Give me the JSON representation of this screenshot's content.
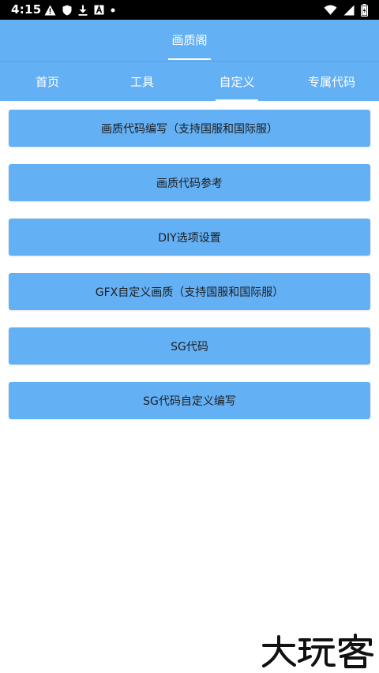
{
  "status_bar": {
    "time": "4:15",
    "left_icons": [
      "warning-icon",
      "shield-icon",
      "download-icon",
      "font-a-icon",
      "dot-icon"
    ],
    "right_icons": [
      "wifi-icon",
      "signal-icon",
      "battery-icon"
    ]
  },
  "app_bar": {
    "title": "画质阁"
  },
  "tabs": [
    {
      "label": "首页",
      "selected": false
    },
    {
      "label": "工具",
      "selected": false
    },
    {
      "label": "自定义",
      "selected": true
    },
    {
      "label": "专属代码",
      "selected": false
    }
  ],
  "buttons": [
    {
      "label": "画质代码编写（支持国服和国际服）"
    },
    {
      "label": "画质代码参考"
    },
    {
      "label": "DIY选项设置"
    },
    {
      "label": "GFX自定义画质（支持国服和国际服）"
    },
    {
      "label": "SG代码"
    },
    {
      "label": "SG代码自定义编写"
    }
  ],
  "watermark": {
    "text": "大玩客"
  },
  "colors": {
    "primary": "#64b0f4",
    "status_bar": "#000000",
    "text_on_primary": "#ffffff",
    "button_text": "#1d1d1d"
  }
}
